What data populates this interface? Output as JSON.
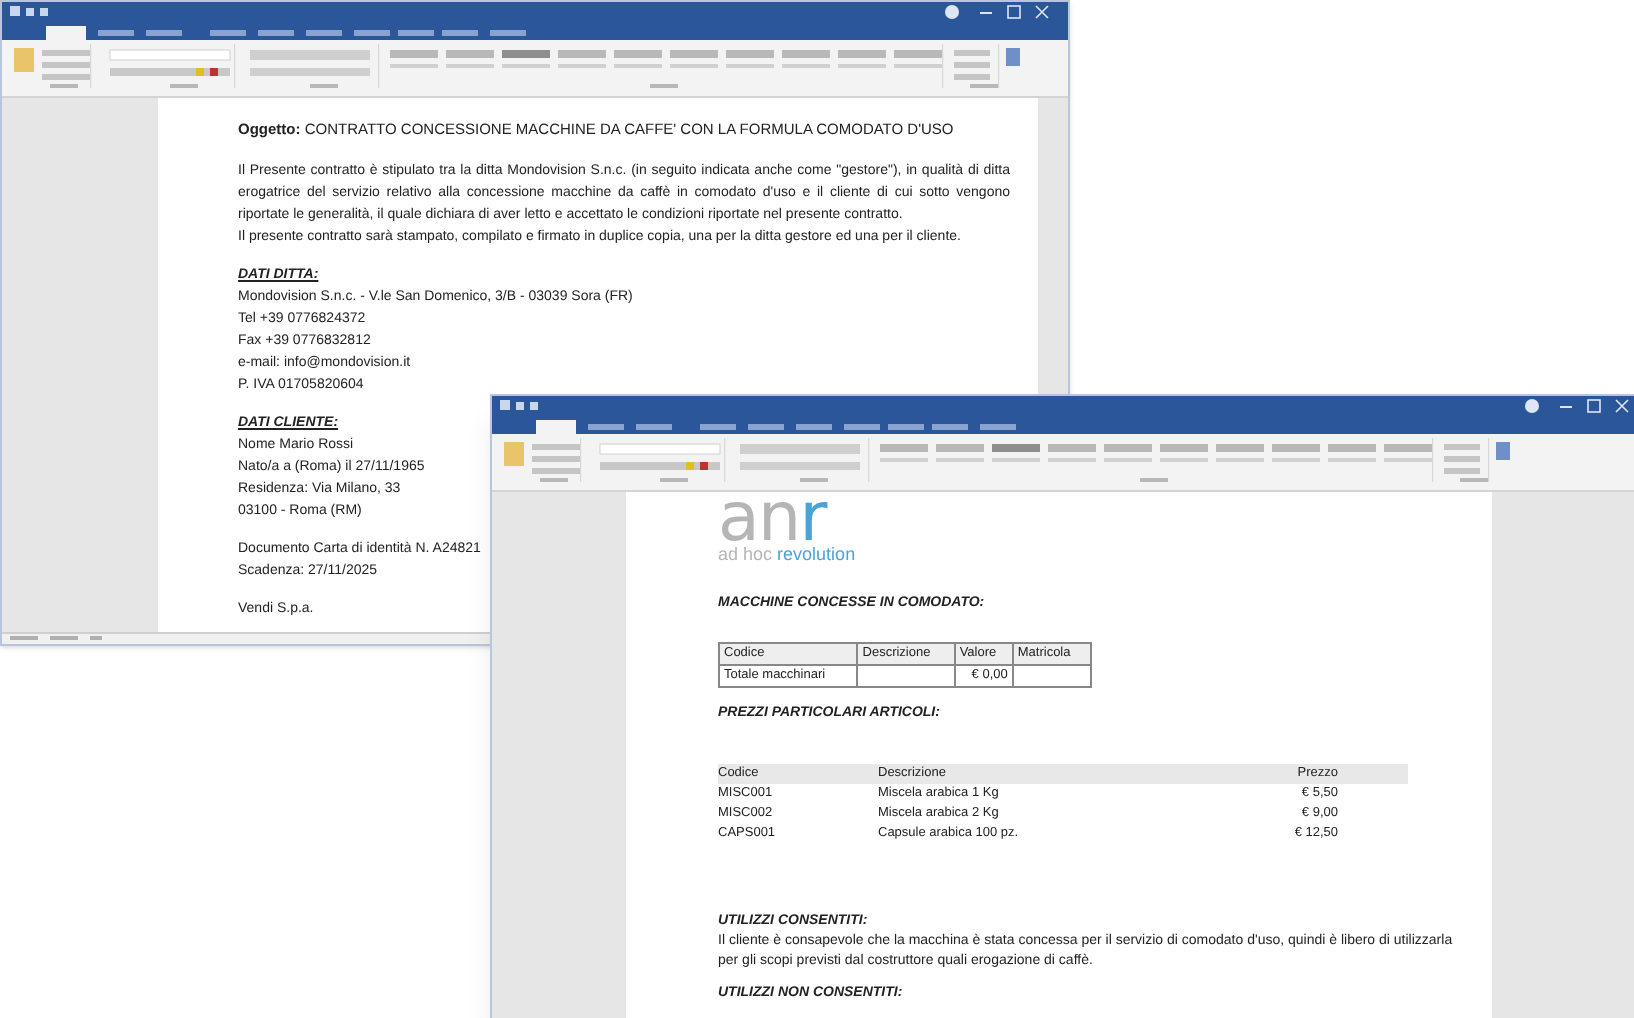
{
  "back_window": {
    "document": {
      "subject": {
        "label": "Oggetto:",
        "text": "CONTRATTO CONCESSIONE MACCHINE DA CAFFE' CON LA FORMULA COMODATO D'USO"
      },
      "paragraphs": [
        "Il Presente contratto è stipulato tra la ditta Mondovision S.n.c. (in seguito indicata anche come \"gestore\"), in qualità di ditta erogatrice del servizio relativo alla concessione macchine da caffè in comodato d'uso e il cliente di cui sotto vengono riportate le generalità, il quale dichiara di aver letto e accettato le condizioni riportate nel presente contratto.",
        "Il presente contratto sarà stampato, compilato e firmato in duplice copia, una per la ditta gestore ed una per il cliente."
      ],
      "sections": [
        {
          "heading": "DATI DITTA:",
          "lines": [
            "Mondovision S.n.c. - V.le San Domenico, 3/B - 03039 Sora (FR)",
            "Tel +39 0776824372",
            "Fax +39 0776832812",
            "e-mail: info@mondovision.it",
            "P. IVA 01705820604"
          ]
        },
        {
          "heading": "DATI CLIENTE:",
          "lines": [
            "Nome Mario Rossi",
            "Nato/a a (Roma) il 27/11/1965",
            "Residenza: Via Milano, 33",
            "03100 - Roma (RM)"
          ]
        },
        {
          "lines": [
            "Documento Carta di identità N. A24821",
            "Scadenza:  27/11/2025"
          ]
        },
        {
          "lines": [
            "Vendi S.p.a."
          ]
        }
      ]
    }
  },
  "front_window": {
    "document": {
      "logo": {
        "main": "an",
        "accent": "r"
      },
      "tagline": {
        "main": "ad hoc",
        "accent": "revolution"
      },
      "machines": {
        "heading": "MACCHINE CONCESSE IN COMODATO:",
        "columns": [
          "Codice",
          "Descrizione",
          "Valore",
          "Matricola"
        ],
        "rows": [
          {
            "cells": [
              "Totale macchinari",
              null,
              "€ 0,00",
              null
            ]
          }
        ]
      },
      "prices": {
        "heading": "PREZZI PARTICOLARI ARTICOLI:",
        "columns": [
          "Codice",
          "Descrizione",
          "Prezzo"
        ],
        "rows": [
          {
            "cells": [
              "MISC001",
              "Miscela arabica 1 Kg",
              "€ 5,50"
            ]
          },
          {
            "cells": [
              "MISC002",
              "Miscela arabica 2 Kg",
              "€ 9,00"
            ]
          },
          {
            "cells": [
              "CAPS001",
              "Capsule arabica 100 pz.",
              "€ 12,50"
            ]
          }
        ]
      },
      "uses": [
        {
          "heading": "UTILIZZI CONSENTITI:",
          "text": "Il cliente è consapevole che la macchina è stata concessa per il servizio di comodato d'uso, quindi è libero di utilizzarla per gli scopi previsti dal costruttore quali erogazione di caffè."
        },
        {
          "heading": "UTILIZZI NON CONSENTITI:"
        }
      ]
    }
  }
}
